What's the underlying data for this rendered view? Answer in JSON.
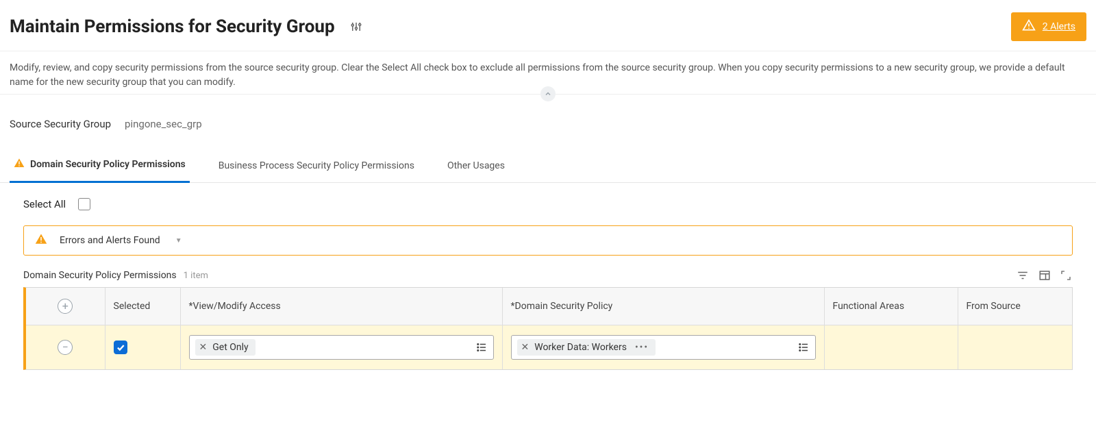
{
  "header": {
    "title": "Maintain Permissions for Security Group",
    "alerts_label": "2 Alerts"
  },
  "description": "Modify, review, and copy security permissions from the source security group. Clear the Select All check box to exclude all permissions from the source security group. When you copy security permissions to a new security group, we provide a default name for the new security group that you can modify.",
  "source": {
    "label": "Source Security Group",
    "value": "pingone_sec_grp"
  },
  "tabs": [
    {
      "label": "Domain Security Policy Permissions",
      "active": true,
      "has_alert": true
    },
    {
      "label": "Business Process Security Policy Permissions",
      "active": false,
      "has_alert": false
    },
    {
      "label": "Other Usages",
      "active": false,
      "has_alert": false
    }
  ],
  "select_all": {
    "label": "Select All",
    "checked": false
  },
  "alert_banner": {
    "text": "Errors and Alerts Found"
  },
  "grid": {
    "title": "Domain Security Policy Permissions",
    "count_label": "1 item",
    "columns": {
      "selected": "Selected",
      "view": "*View/Modify Access",
      "policy": "*Domain Security Policy",
      "func": "Functional Areas",
      "source": "From Source"
    },
    "rows": [
      {
        "selected": true,
        "view_chip": "Get Only",
        "policy_chip": "Worker Data: Workers",
        "functional_areas": "",
        "from_source": ""
      }
    ]
  },
  "icons": {
    "plus": "+",
    "minus": "−"
  }
}
